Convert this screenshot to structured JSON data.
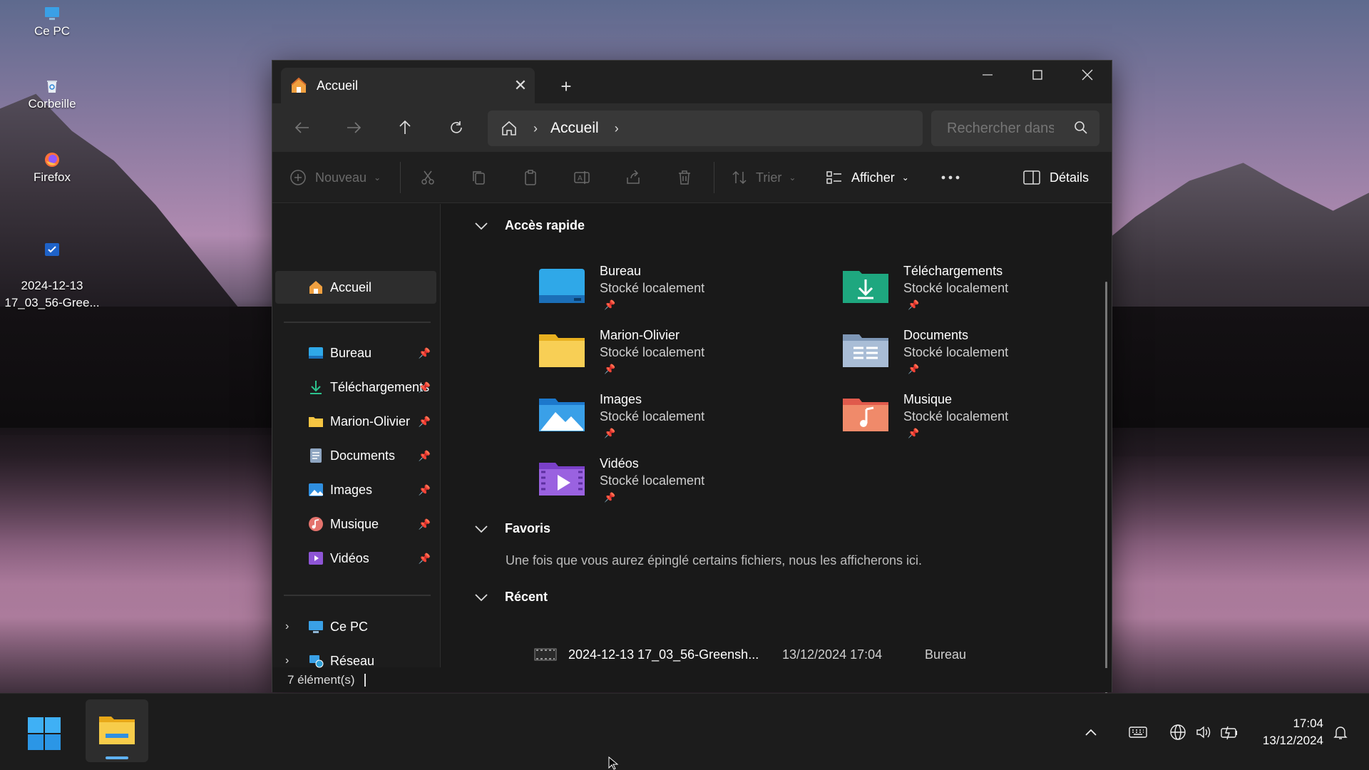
{
  "desktop": {
    "icons": [
      {
        "label": "Ce PC"
      },
      {
        "label": "Corbeille"
      },
      {
        "label": "Firefox"
      },
      {
        "label": "2024-12-13\n17_03_56-Gree..."
      }
    ]
  },
  "window": {
    "tab_title": "Accueil",
    "address": {
      "crumb": "Accueil"
    },
    "search": {
      "placeholder": "Rechercher dans"
    },
    "toolbar": {
      "new_label": "Nouveau",
      "sort_label": "Trier",
      "view_label": "Afficher",
      "details_label": "Détails"
    },
    "sidebar": {
      "home": "Accueil",
      "pinned": [
        {
          "label": "Bureau"
        },
        {
          "label": "Téléchargements"
        },
        {
          "label": "Marion-Olivier"
        },
        {
          "label": "Documents"
        },
        {
          "label": "Images"
        },
        {
          "label": "Musique"
        },
        {
          "label": "Vidéos"
        }
      ],
      "tree": [
        {
          "label": "Ce PC"
        },
        {
          "label": "Réseau"
        }
      ]
    },
    "content": {
      "quick_access": {
        "title": "Accès rapide",
        "items": [
          {
            "name": "Bureau",
            "sub": "Stocké localement"
          },
          {
            "name": "Téléchargements",
            "sub": "Stocké localement"
          },
          {
            "name": "Marion-Olivier",
            "sub": "Stocké localement"
          },
          {
            "name": "Documents",
            "sub": "Stocké localement"
          },
          {
            "name": "Images",
            "sub": "Stocké localement"
          },
          {
            "name": "Musique",
            "sub": "Stocké localement"
          },
          {
            "name": "Vidéos",
            "sub": "Stocké localement"
          }
        ]
      },
      "favorites": {
        "title": "Favoris",
        "empty_text": "Une fois que vous aurez épinglé certains fichiers, nous les afficherons ici."
      },
      "recent": {
        "title": "Récent",
        "rows": [
          {
            "name": "2024-12-13 17_03_56-Greensh...",
            "date": "13/12/2024 17:04",
            "location": "Bureau"
          }
        ]
      }
    },
    "status": {
      "count": "7 élément(s)"
    }
  },
  "taskbar": {
    "time": "17:04",
    "date": "13/12/2024"
  },
  "colors": {
    "accent": "#5fb2f2",
    "window_bg": "#191919",
    "folder_yellow": "#f5c542",
    "download_green": "#1ea77f"
  }
}
